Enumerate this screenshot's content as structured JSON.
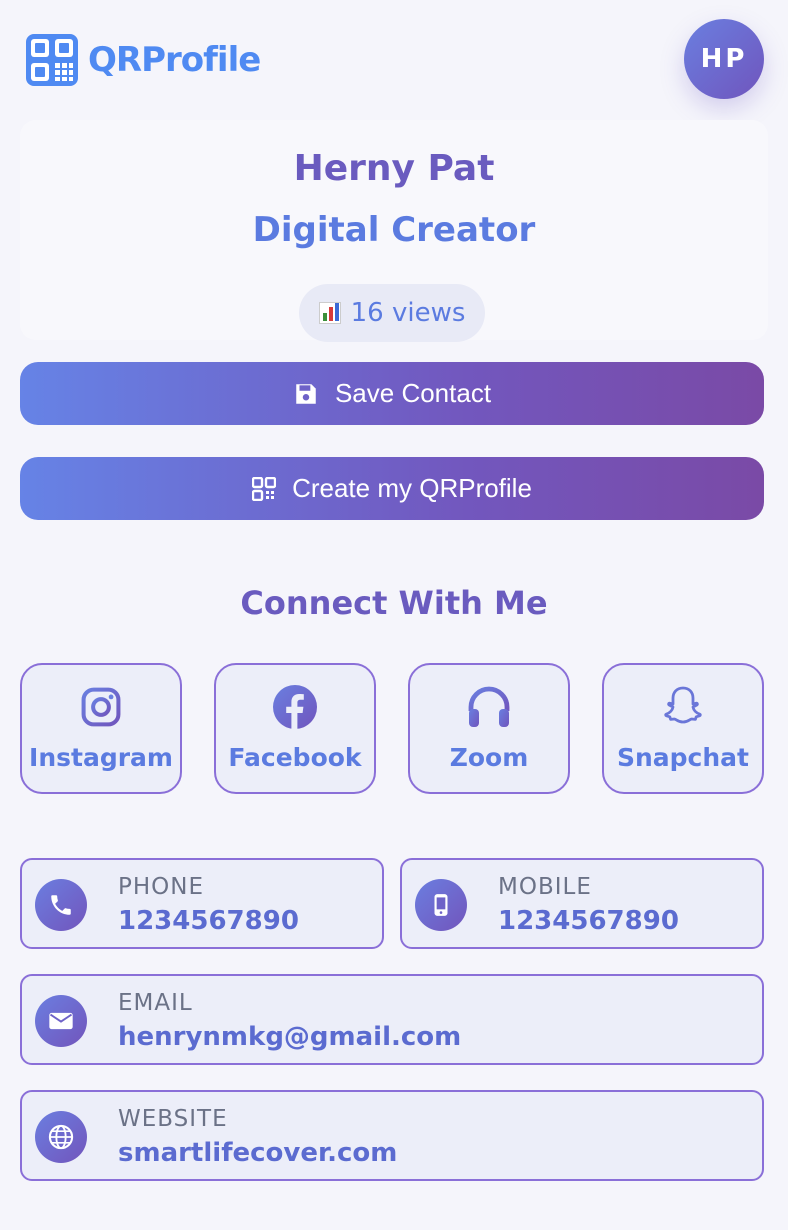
{
  "header": {
    "logo_text": "QRProfile",
    "avatar_initials": "HP"
  },
  "profile": {
    "name": "Herny Pat",
    "title": "Digital Creator",
    "views": "16 views"
  },
  "actions": {
    "save_label": "Save Contact",
    "create_label": "Create my QRProfile"
  },
  "connect": {
    "heading": "Connect With Me",
    "items": [
      {
        "label": "Instagram",
        "icon": "instagram-icon"
      },
      {
        "label": "Facebook",
        "icon": "facebook-icon"
      },
      {
        "label": "Zoom",
        "icon": "headphones-icon"
      },
      {
        "label": "Snapchat",
        "icon": "snapchat-icon"
      }
    ]
  },
  "contacts": {
    "phone": {
      "label": "PHONE",
      "value": "1234567890",
      "icon": "phone-icon"
    },
    "mobile": {
      "label": "MOBILE",
      "value": "1234567890",
      "icon": "mobile-icon"
    },
    "email": {
      "label": "EMAIL",
      "value": "henrynmkg@gmail.com",
      "icon": "envelope-icon"
    },
    "website": {
      "label": "WEBSITE",
      "value": "smartlifecover.com",
      "icon": "globe-icon"
    }
  },
  "colors": {
    "accent": "#5b7be0",
    "accent_purple": "#7257be",
    "background": "#f5f5fb"
  }
}
